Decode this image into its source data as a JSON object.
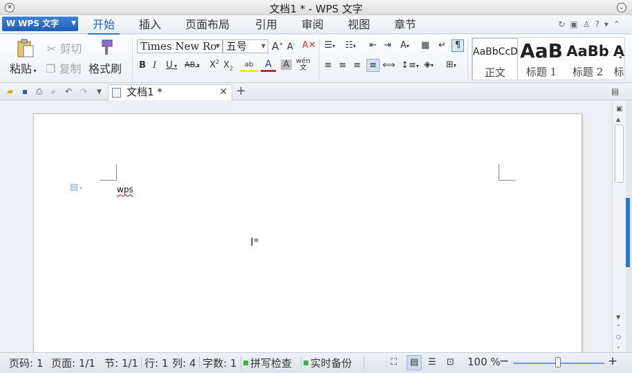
{
  "window": {
    "title": "文档1 * - WPS 文字"
  },
  "app_button": {
    "label": "WPS 文字",
    "logo": "W"
  },
  "menu": {
    "tabs": [
      "开始",
      "插入",
      "页面布局",
      "引用",
      "审阅",
      "视图",
      "章节"
    ],
    "active_index": 0
  },
  "ribbon": {
    "clipboard": {
      "paste": "粘贴",
      "cut": "剪切",
      "copy": "复制",
      "format_painter": "格式刷"
    },
    "font": {
      "family": "Times New Ro",
      "size": "五号"
    },
    "styles": [
      {
        "preview": "AaBbCcD",
        "label": "正文"
      },
      {
        "preview": "AaB",
        "label": "标题 1"
      },
      {
        "preview": "AaBb",
        "label": "标题 2"
      },
      {
        "preview": "A",
        "label": "标"
      }
    ]
  },
  "document_tab": {
    "name": "文档1 *"
  },
  "document": {
    "text": "wps"
  },
  "status_bar": {
    "page_no": "页码: 1",
    "pages": "页面: 1/1",
    "section": "节: 1/1",
    "row": "行: 1",
    "col": "列: 4",
    "word_count": "字数: 1",
    "spell_check": "拼写检查",
    "backup": "实时备份",
    "zoom": "100 %",
    "zoom_level_percent": 100
  },
  "colors": {
    "accent": "#2f73cf",
    "app_button": "#2a6cc4",
    "status_green": "#3cb43c",
    "spell_underline": "#dd3333"
  }
}
